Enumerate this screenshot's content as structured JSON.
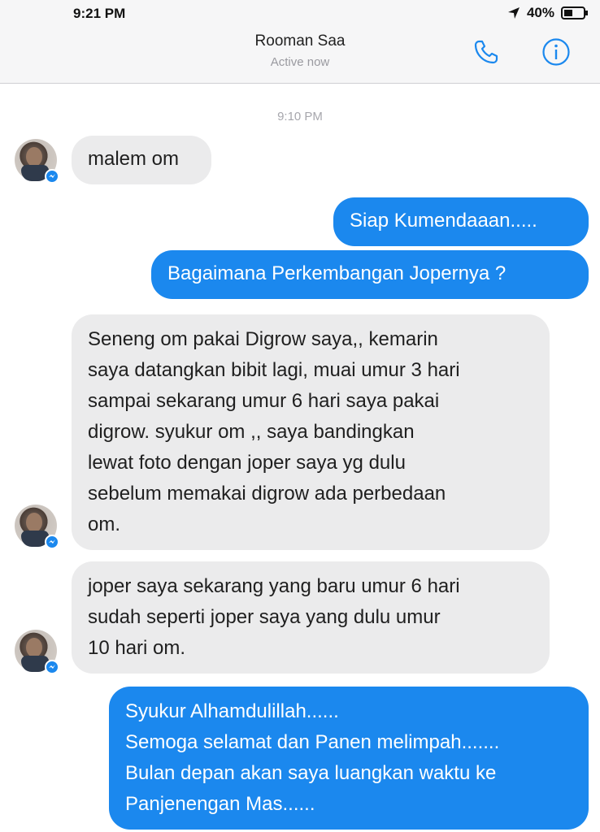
{
  "status_bar": {
    "time": "9:21 PM",
    "battery": "40%"
  },
  "header": {
    "contact_name": "Rooman Saa",
    "contact_status": "Active now"
  },
  "chat": {
    "timestamp": "9:10 PM",
    "messages": [
      {
        "side": "in",
        "text": "malem om"
      },
      {
        "side": "out",
        "text": "Siap Kumendaaan....."
      },
      {
        "side": "out",
        "text": "Bagaimana Perkembangan Jopernya ?"
      },
      {
        "side": "in",
        "lines": [
          "Seneng om pakai Digrow saya,, kemarin",
          "saya datangkan bibit lagi, muai umur 3 hari",
          "sampai sekarang umur 6 hari saya pakai",
          "digrow. syukur om ,, saya bandingkan",
          "lewat foto dengan joper saya yg dulu",
          "sebelum memakai digrow ada perbedaan",
          "om."
        ]
      },
      {
        "side": "in",
        "lines": [
          "joper saya sekarang yang baru umur 6 hari",
          "sudah seperti joper saya yang dulu umur",
          "10 hari om."
        ]
      },
      {
        "side": "out",
        "lines": [
          "Syukur Alhamdulillah......",
          "Semoga selamat dan Panen melimpah.......",
          "Bulan depan akan saya luangkan waktu ke",
          "Panjenengan Mas......"
        ]
      }
    ]
  },
  "colors": {
    "outgoing_bubble": "#1b88ee",
    "incoming_bubble": "#ebebec",
    "accent": "#1b88ee"
  },
  "icons": [
    "location-arrow-icon",
    "battery-icon",
    "phone-icon",
    "info-icon",
    "messenger-badge-icon"
  ]
}
